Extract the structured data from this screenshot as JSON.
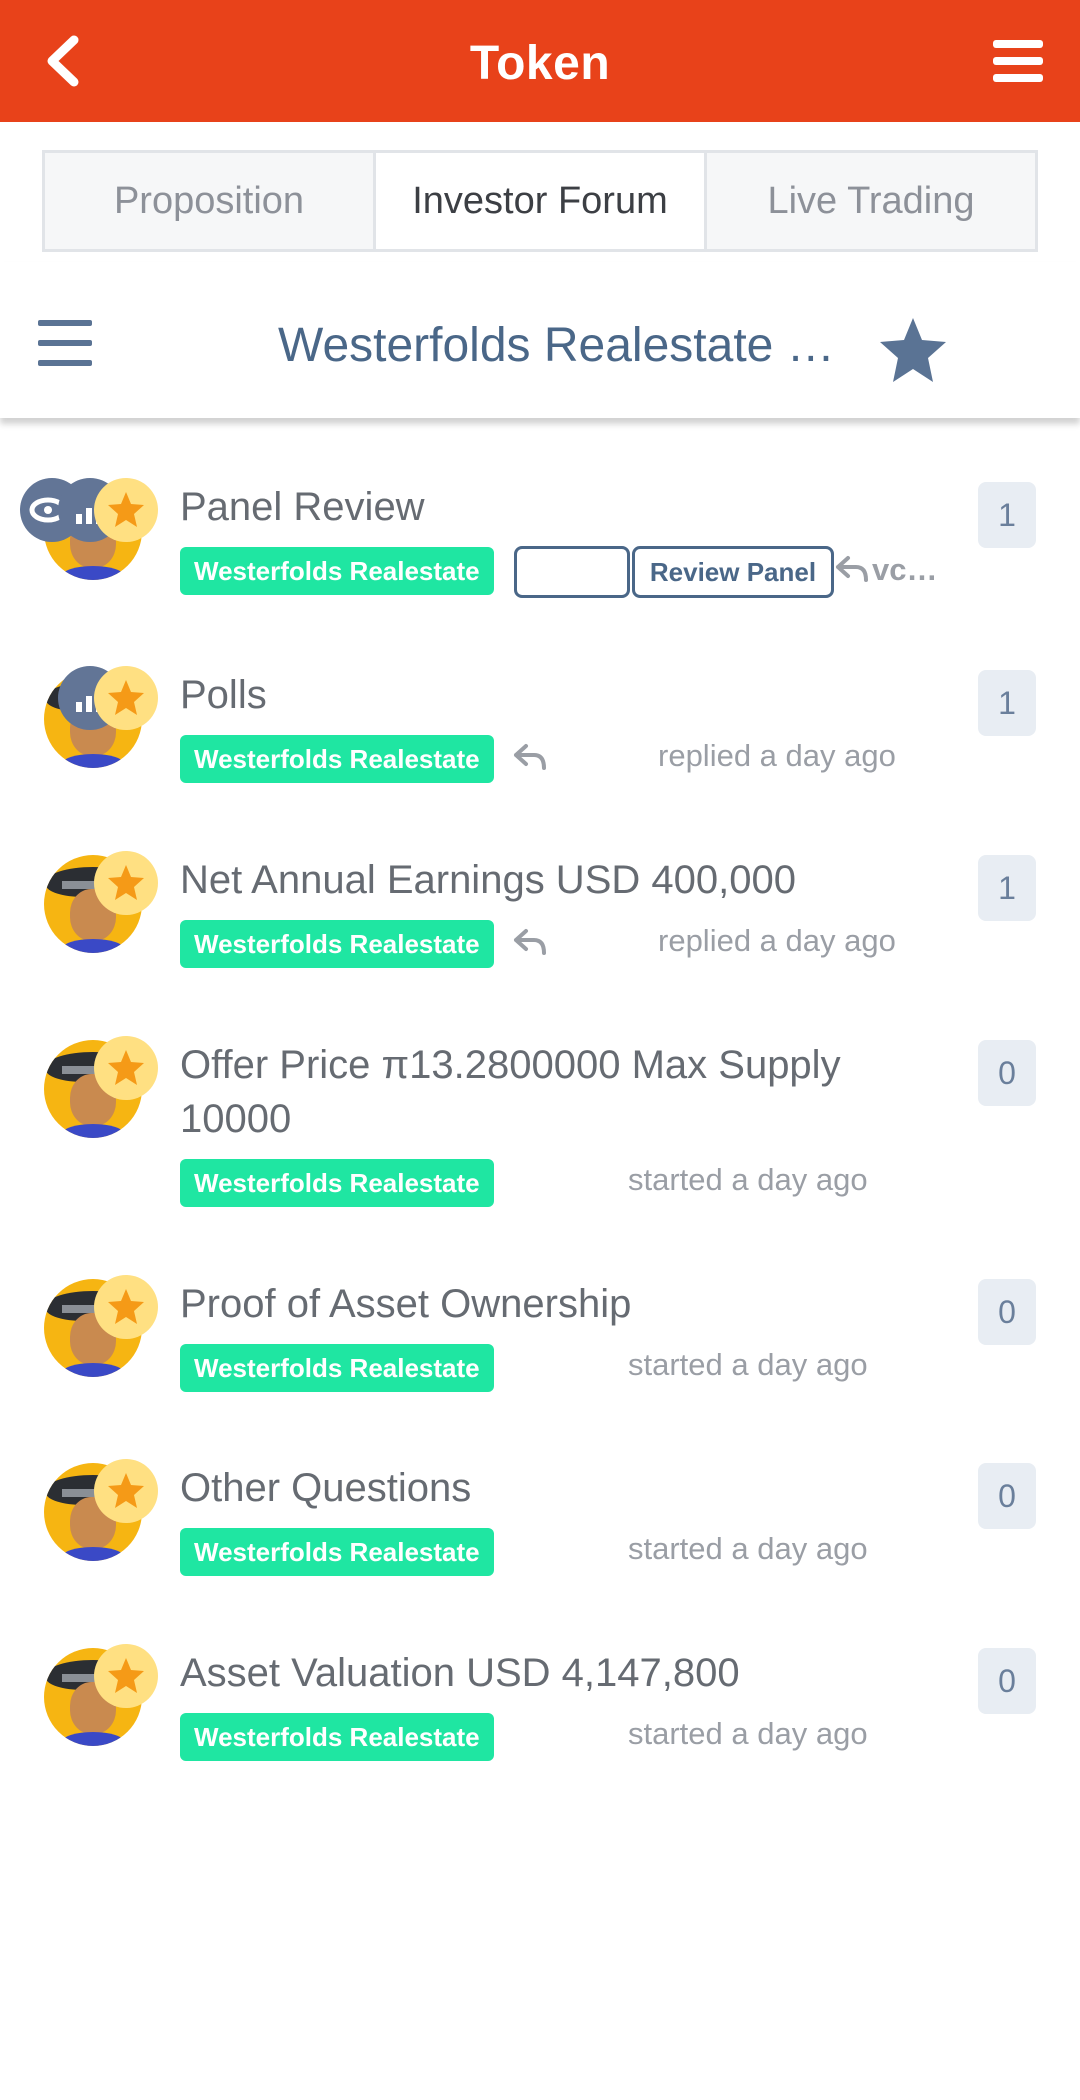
{
  "appbar": {
    "title": "Token",
    "back_icon": "chevron-left-icon",
    "menu_icon": "menu-icon",
    "color": "#e8421a"
  },
  "tabs": [
    {
      "label": "Proposition",
      "active": false
    },
    {
      "label": "Investor Forum",
      "active": true
    },
    {
      "label": "Live Trading",
      "active": false
    }
  ],
  "category": {
    "title": "Westerfolds Realestate  …",
    "menu_icon": "hamburger-icon",
    "star_icon": "star-icon"
  },
  "topics": [
    {
      "title": "Panel Review",
      "tag": "Westerfolds Realestate",
      "extra_tags": [
        "",
        "Review Panel"
      ],
      "meta": "vc…",
      "count": "1",
      "badges": [
        "eye",
        "poll",
        "star"
      ]
    },
    {
      "title": "Polls",
      "tag": "Westerfolds Realestate",
      "meta": "replied a day ago",
      "count": "1",
      "badges": [
        "poll",
        "star"
      ]
    },
    {
      "title": "Net Annual Earnings USD 400,000",
      "tag": "Westerfolds Realestate",
      "meta": "replied a day ago",
      "count": "1",
      "badges": [
        "star"
      ]
    },
    {
      "title_line1": "Offer Price π13.2800000 Max Supply",
      "title_line2": "10000",
      "tag": "Westerfolds Realestate",
      "meta": "started a day ago",
      "count": "0",
      "badges": [
        "star"
      ]
    },
    {
      "title": "Proof of Asset Ownership",
      "tag": "Westerfolds Realestate",
      "meta": "started a day ago",
      "count": "0",
      "badges": [
        "star"
      ]
    },
    {
      "title": "Other Questions",
      "tag": "Westerfolds Realestate",
      "meta": "started a day ago",
      "count": "0",
      "badges": [
        "star"
      ]
    },
    {
      "title": "Asset Valuation USD 4,147,800",
      "tag": "Westerfolds Realestate",
      "meta": "started a day ago",
      "count": "0",
      "badges": [
        "star"
      ]
    }
  ],
  "colors": {
    "tag_bg": "#1fe6a2",
    "count_bg": "#e8edf3",
    "title_text": "#4a6788"
  }
}
